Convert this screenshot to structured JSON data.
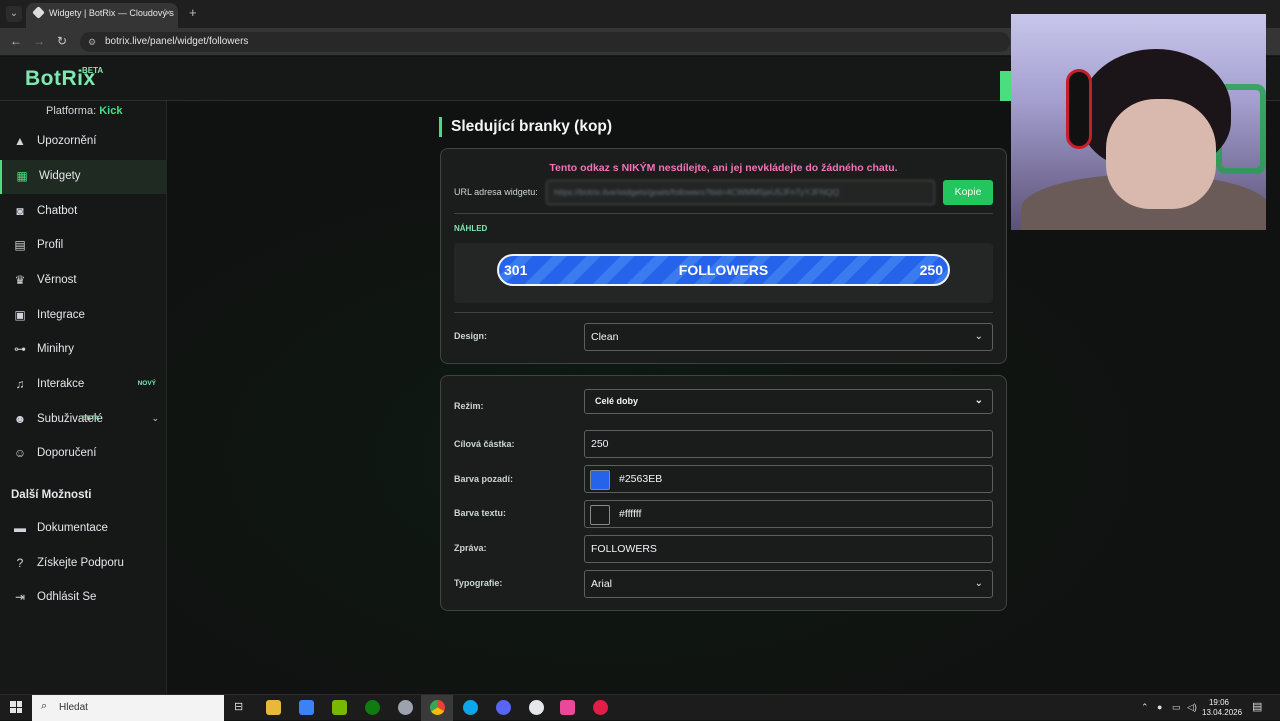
{
  "browser": {
    "tab_title": "Widgety | BotRix — Cloudový s",
    "url": "botrix.live/panel/widget/followers",
    "new_tab": "+",
    "tab_close": "×"
  },
  "app": {
    "logo": "BotRix",
    "logo_badge": "BETA",
    "platform_label": "Platforma:",
    "platform_value": "Kick"
  },
  "sidebar": {
    "items": [
      {
        "label": "Upozornění",
        "icon": "warning-icon"
      },
      {
        "label": "Widgety",
        "icon": "widgets-icon"
      },
      {
        "label": "Chatbot",
        "icon": "robot-icon"
      },
      {
        "label": "Profil",
        "icon": "profile-card-icon"
      },
      {
        "label": "Věrnost",
        "icon": "trophy-icon"
      },
      {
        "label": "Integrace",
        "icon": "integration-icon"
      },
      {
        "label": "Minihry",
        "icon": "gamepad-icon"
      },
      {
        "label": "Interakce",
        "icon": "music-note-icon",
        "badge": "NOVÝ"
      },
      {
        "label": "Subuživatelé",
        "icon": "users-icon",
        "badge": "BETA"
      },
      {
        "label": "Doporučení",
        "icon": "referral-icon"
      }
    ],
    "section_title": "Další Možnosti",
    "more_items": [
      {
        "label": "Dokumentace",
        "icon": "document-icon"
      },
      {
        "label": "Získejte Podporu",
        "icon": "help-icon"
      },
      {
        "label": "Odhlásit Se",
        "icon": "logout-icon"
      }
    ]
  },
  "main": {
    "page_title": "Sledující branky (kop)",
    "warning": "Tento odkaz s NIKÝM nesdílejte, ani jej nevkládejte do žádného chatu.",
    "url_label": "URL adresa widgetu:",
    "url_value": "https://botrix.live/widgets/goals/followers?bid=4CWMM5jeU5JFnTyYJFNQQ",
    "copy_button": "Kopie",
    "preview_label": "NÁHLED",
    "goal": {
      "current": "301",
      "text": "FOLLOWERS",
      "target": "250",
      "bar_color": "#2563EB"
    },
    "design_label": "Design:",
    "design_value": "Clean",
    "mode_label": "Režim:",
    "mode_value": "Celé doby",
    "target_label": "Cílová částka:",
    "target_value": "250",
    "bg_label": "Barva pozadí:",
    "bg_value": "#2563EB",
    "text_color_label": "Barva textu:",
    "text_color_value": "#ffffff",
    "message_label": "Zpráva:",
    "message_value": "FOLLOWERS",
    "typography_label": "Typografie:",
    "typography_value": "Arial"
  },
  "taskbar": {
    "search_placeholder": "Hledat",
    "time": "19:06",
    "date": "13.04.2026"
  },
  "colors": {
    "accent": "#4ade80",
    "warning": "#f472b6",
    "copy_button": "#22c55e"
  }
}
